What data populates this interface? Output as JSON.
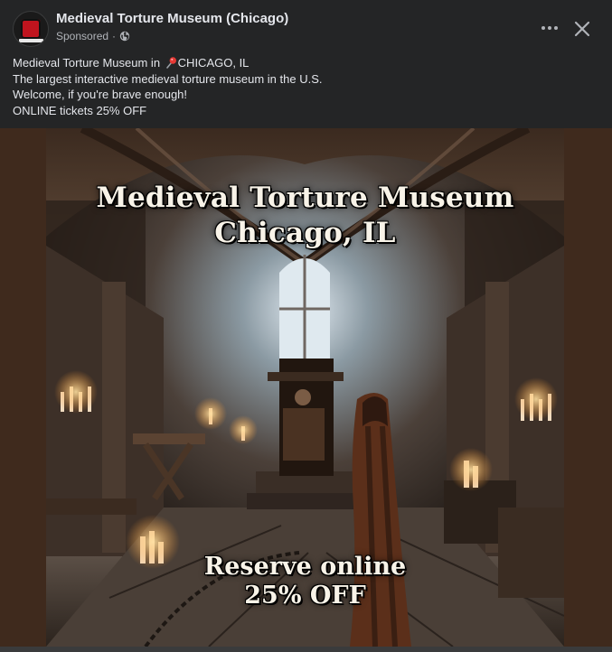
{
  "header": {
    "page_name": "Medieval Torture Museum (Chicago)",
    "sponsored_label": "Sponsored",
    "separator": "·",
    "more_icon": "more-horizontal-icon",
    "close_icon": "close-icon",
    "globe_icon": "globe-icon"
  },
  "caption": {
    "line1_prefix": "Medieval Torture Museum in ",
    "line1_icon": "round-pushpin-icon",
    "line1_suffix": "CHICAGO, IL",
    "line2": "The largest interactive medieval torture museum in the U.S.",
    "line3": "Welcome, if you're brave enough!",
    "line4": "ONLINE tickets 25% OFF"
  },
  "ad_image": {
    "headline_line1": "Medieval Torture Museum",
    "headline_line2": "Chicago, IL",
    "cta_line1": "Reserve online",
    "cta_line2": "25% OFF"
  },
  "colors": {
    "background": "#242526",
    "media_side": "#3f2a1d",
    "text_primary": "#e4e6eb",
    "text_secondary": "#b0b3b8",
    "avatar_red": "#c0141e"
  }
}
